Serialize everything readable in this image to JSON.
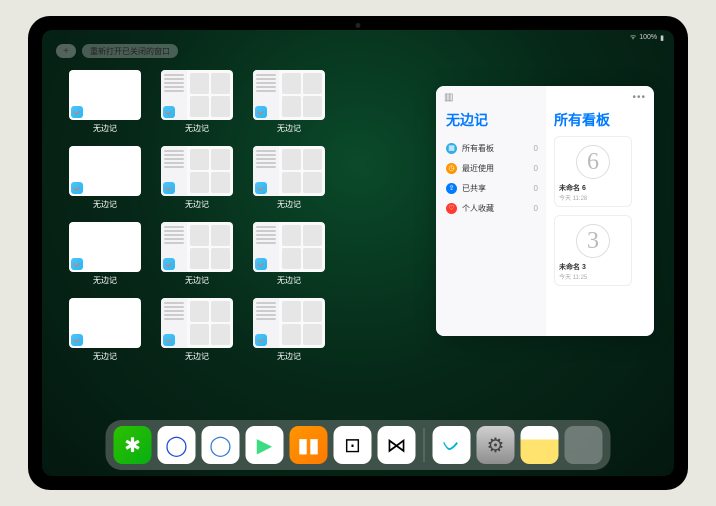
{
  "status": {
    "battery": "100%",
    "wifi": "●●●"
  },
  "top": {
    "plus": "+",
    "reopen_label": "重新打开已关闭的窗口"
  },
  "app_name": "无边记",
  "windows": [
    {
      "label": "无边记",
      "style": "blank"
    },
    {
      "label": "无边记",
      "style": "detailed"
    },
    {
      "label": "无边记",
      "style": "detailed"
    },
    {
      "label": "无边记",
      "style": "blank"
    },
    {
      "label": "无边记",
      "style": "detailed"
    },
    {
      "label": "无边记",
      "style": "detailed"
    },
    {
      "label": "无边记",
      "style": "blank"
    },
    {
      "label": "无边记",
      "style": "detailed"
    },
    {
      "label": "无边记",
      "style": "detailed"
    },
    {
      "label": "无边记",
      "style": "blank"
    },
    {
      "label": "无边记",
      "style": "detailed"
    },
    {
      "label": "无边记",
      "style": "detailed"
    }
  ],
  "panel": {
    "left_title": "无边记",
    "right_title": "所有看板",
    "sidebar": [
      {
        "icon_color": "#32ade6",
        "glyph": "▦",
        "label": "所有看板",
        "count": "0"
      },
      {
        "icon_color": "#ff9500",
        "glyph": "◷",
        "label": "最近使用",
        "count": "0"
      },
      {
        "icon_color": "#007aff",
        "glyph": "⇪",
        "label": "已共享",
        "count": "0"
      },
      {
        "icon_color": "#ff3b30",
        "glyph": "♡",
        "label": "个人收藏",
        "count": "0"
      }
    ],
    "boards": [
      {
        "glyph": "6",
        "name": "未命名 6",
        "date": "今天 11:28"
      },
      {
        "glyph": "3",
        "name": "未命名 3",
        "date": "今天 11:25"
      }
    ]
  },
  "dock": [
    {
      "name": "wechat",
      "bg": "linear-gradient(135deg,#2dc100,#07af12)",
      "glyph": "✱",
      "glyphColor": "#fff"
    },
    {
      "name": "browser-qq",
      "bg": "#fff",
      "glyph": "◯",
      "glyphColor": "#1e4bd6"
    },
    {
      "name": "quark",
      "bg": "#fff",
      "glyph": "◯",
      "glyphColor": "#3a7bd5"
    },
    {
      "name": "play-video",
      "bg": "#fff",
      "glyph": "▶",
      "glyphColor": "#3ddc84"
    },
    {
      "name": "books",
      "bg": "linear-gradient(135deg,#ff9500,#ff7a00)",
      "glyph": "▮▮",
      "glyphColor": "#fff"
    },
    {
      "name": "dice",
      "bg": "#fff",
      "glyph": "⊡",
      "glyphColor": "#000"
    },
    {
      "name": "connect",
      "bg": "#fff",
      "glyph": "⋈",
      "glyphColor": "#000"
    },
    {
      "name": "freeform",
      "bg": "#fff",
      "glyph": "ᨆ",
      "glyphColor": "#06b6d4"
    },
    {
      "name": "settings",
      "bg": "linear-gradient(#cfcfcf,#8e8e8e)",
      "glyph": "⚙",
      "glyphColor": "#444"
    },
    {
      "name": "notes",
      "bg": "linear-gradient(#fff 35%,#ffe36e 35%)",
      "glyph": "",
      "glyphColor": "#000"
    }
  ],
  "dock_folder": {
    "minis": [
      "#2b7de9",
      "#34c759",
      "#ff9500",
      "#5ac8fa"
    ]
  }
}
